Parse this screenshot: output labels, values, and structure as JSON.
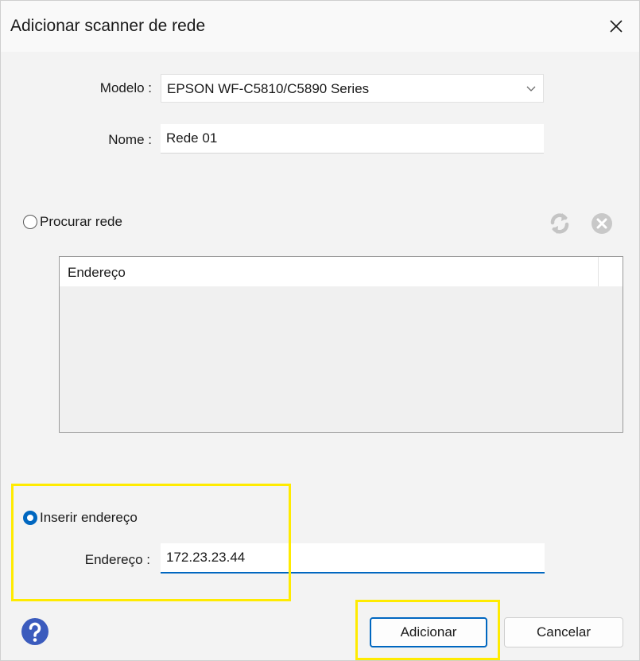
{
  "dialog": {
    "title": "Adicionar scanner de rede"
  },
  "form": {
    "model_label": "Modelo :",
    "model_value": "EPSON WF-C5810/C5890 Series",
    "name_label": "Nome :",
    "name_value": "Rede 01"
  },
  "search": {
    "radio_label": "Procurar rede",
    "selected": false,
    "list_columns": [
      "Endereço"
    ],
    "list_rows": []
  },
  "manual": {
    "radio_label": "Inserir endereço",
    "selected": true,
    "address_label": "Endereço :",
    "address_value": "172.23.23.44"
  },
  "buttons": {
    "add_label": "Adicionar",
    "cancel_label": "Cancelar"
  },
  "colors": {
    "accent": "#0067c0",
    "highlight": "#ffeb00",
    "help_icon": "#3b5bbd"
  },
  "icons": {
    "close": "close-icon",
    "refresh": "refresh-icon",
    "stop": "stop-icon",
    "help": "help-icon",
    "dropdown": "chevron-down-icon"
  }
}
